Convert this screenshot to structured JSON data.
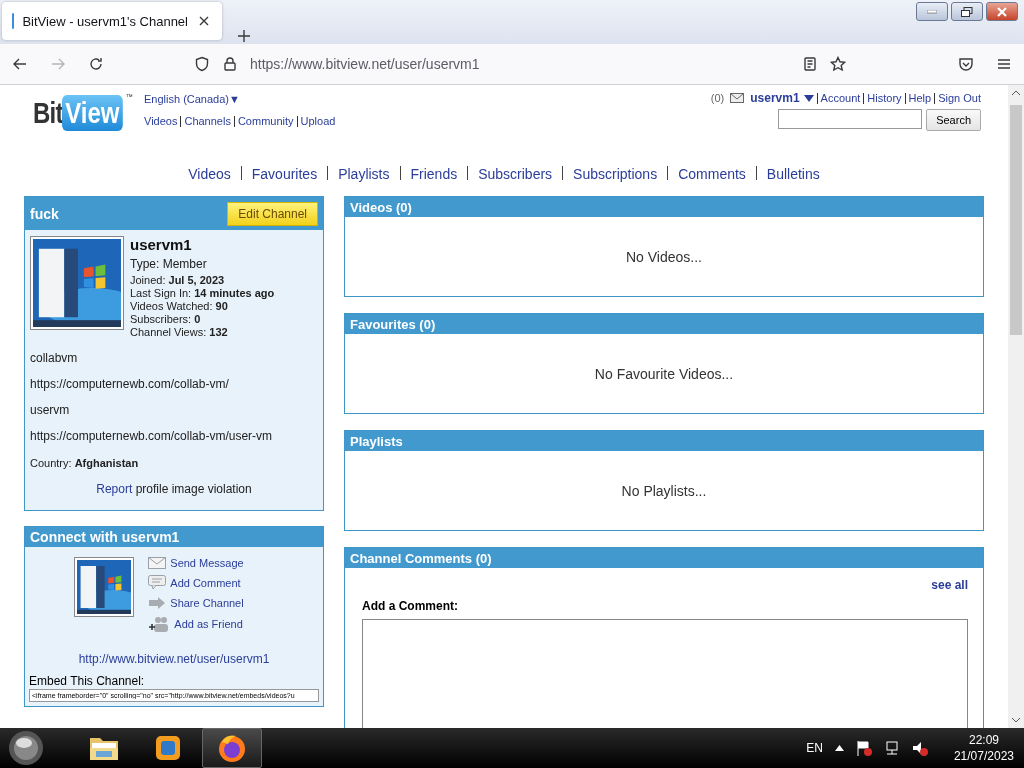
{
  "browser": {
    "tab_title": "BitView - uservm1's Channel",
    "url": "https://www.bitview.net/user/uservm1"
  },
  "header": {
    "logo_left": "Bit",
    "logo_right": "View",
    "logo_mark": "™",
    "language": "English (Canada)▼",
    "nav": [
      "Videos",
      "Channels",
      "Community",
      "Upload"
    ],
    "user": {
      "inbox_count": "(0)",
      "name": "uservm1",
      "links": [
        "Account",
        "History",
        "Help",
        "Sign Out"
      ]
    },
    "search_button": "Search"
  },
  "channel_nav": [
    "Videos",
    "Favourites",
    "Playlists",
    "Friends",
    "Subscribers",
    "Subscriptions",
    "Comments",
    "Bulletins"
  ],
  "profile": {
    "title": "fuck",
    "edit_button": "Edit Channel",
    "name": "uservm1",
    "type": "Type: Member",
    "stats": [
      "Joined: **Jul 5, 2023**",
      "Last Sign In: **14 minutes ago**",
      "Videos Watched: **90**",
      "Subscribers: **0**",
      "Channel Views: **132**"
    ],
    "description": [
      "collabvm",
      "https://computernewb.com/collab-vm/",
      "uservm",
      "https://computernewb.com/collab-vm/user-vm"
    ],
    "country": "Country: **Afghanistan**",
    "report_link": "Report",
    "report_text": "profile image violation"
  },
  "connect": {
    "title": "Connect with uservm1",
    "actions": [
      {
        "kind": "message",
        "label": "Send Message"
      },
      {
        "kind": "comment",
        "label": "Add Comment"
      },
      {
        "kind": "share",
        "label": "Share Channel"
      },
      {
        "kind": "friend",
        "label": "Add as Friend"
      }
    ],
    "channel_url": "http://www.bitview.net/user/uservm1",
    "embed_label": "Embed This Channel:",
    "embed_code": "<iframe frameborder=\"0\" scrolling=\"no\" src=\"http://www.bitview.net/embeds/videos?u"
  },
  "sections": [
    {
      "title": "Videos (0)",
      "empty": "No Videos..."
    },
    {
      "title": "Favourites (0)",
      "empty": "No Favourite Videos..."
    },
    {
      "title": "Playlists",
      "empty": "No Playlists..."
    }
  ],
  "comments": {
    "title": "Channel Comments (0)",
    "see_all": "see all",
    "label": "Add a Comment:"
  },
  "taskbar": {
    "apps": [
      {
        "kind": "folder",
        "selected": false
      },
      {
        "kind": "vm",
        "selected": false
      },
      {
        "kind": "browser",
        "selected": true
      }
    ],
    "language": "EN",
    "time": "22:09",
    "date": "21/07/2023"
  }
}
